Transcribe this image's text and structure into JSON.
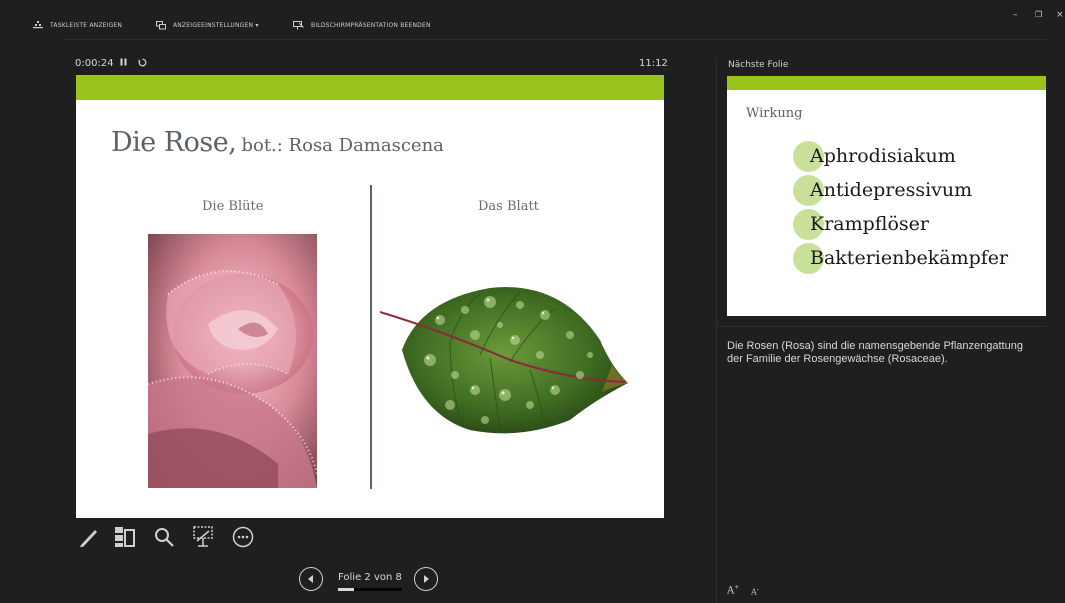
{
  "toolbar": {
    "show_taskbar": "TASKLEISTE ANZEIGEN",
    "display_settings": "ANZEIGEEINSTELLUNGEN ▾",
    "end_slideshow": "BILDSCHIRMPRÄSENTATION BEENDEN"
  },
  "window_controls": {
    "minimize": "–",
    "restore": "❐",
    "close": "×"
  },
  "presenter": {
    "elapsed": "0:00:24",
    "pause_icon": "pause-icon",
    "reset_icon": "reset-icon",
    "clock": "11:12"
  },
  "current_slide": {
    "title": "Die Rose,",
    "subtitle": "bot.: Rosa Damascena",
    "left_heading": "Die Blüte",
    "right_heading": "Das Blatt",
    "accent_color": "#9ac31c"
  },
  "tools": [
    "pen-icon",
    "all-slides-icon",
    "zoom-icon",
    "black-screen-icon",
    "more-options-icon"
  ],
  "navigation": {
    "slide_label": "Folie 2 von 8",
    "current": 2,
    "total": 8,
    "progress_fraction": 0.25
  },
  "next": {
    "label": "Nächste Folie",
    "title": "Wirkung",
    "bullets": [
      "Aphrodisiakum",
      "Antidepressivum",
      "Krampflöser",
      "Bakterienbekämpfer"
    ],
    "bullet_color": "#c9e09b"
  },
  "notes": {
    "text": "Die Rosen (Rosa) sind die namensgebende Pflanzengattung der Familie der Rosengewächse (Rosaceae).",
    "increase_font": "A",
    "decrease_font": "A"
  }
}
